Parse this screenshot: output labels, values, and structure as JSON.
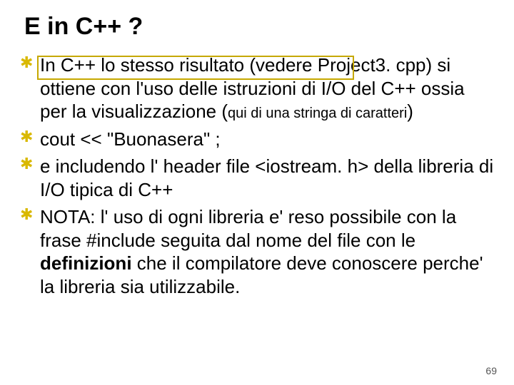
{
  "title": "E in C++ ?",
  "bullets": {
    "b1": {
      "p1": "In C++ lo stesso risultato (vedere",
      "p2": "Project3. cpp) si ottiene con l'uso delle istruzioni di I/O del C++ ossia per la visualizzazione (",
      "p3": "qui di una stringa di caratteri",
      "p4": ")"
    },
    "b2": "cout << \"Buonasera\" ;",
    "b3": "e includendo l' header file <iostream. h> della libreria di I/O tipica di C++",
    "b4": {
      "p1": "NOTA: l' uso di ogni libreria e' reso possibile con la frase #include seguita dal nome del file con le ",
      "p2": "definizioni",
      "p3": " che il compilatore deve conoscere perche' la libreria sia utilizzabile."
    }
  },
  "pagenum": "69"
}
